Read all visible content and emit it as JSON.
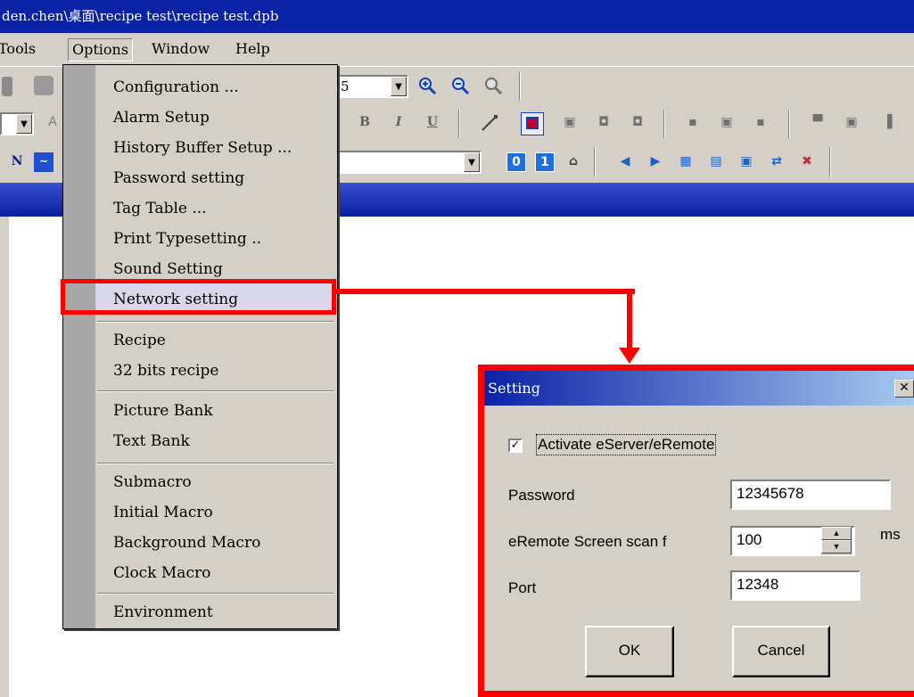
{
  "window": {
    "title": "den.chen\\桌面\\recipe test\\recipe test.dpb"
  },
  "menubar": {
    "tools": "Tools",
    "options": "Options",
    "window": "Window",
    "help": "Help"
  },
  "options_menu": {
    "items": [
      "Configuration ...",
      "Alarm Setup",
      "History Buffer Setup ...",
      "Password setting",
      "Tag Table ...",
      "Print Typesetting ..",
      "Sound Setting",
      "Network setting",
      "Recipe",
      "32 bits recipe",
      "Picture Bank",
      "Text Bank",
      "Submacro",
      "Initial Macro",
      "Background Macro",
      "Clock Macro",
      "Environment"
    ],
    "highlighted": "Network setting"
  },
  "toolbar": {
    "combo1_value": "5",
    "bold": "B",
    "italic": "I",
    "underline": "U"
  },
  "dialog": {
    "title": "Setting",
    "close": "✕",
    "activate_label": "Activate eServer/eRemote",
    "activate_checked": "✓",
    "password_label": "Password",
    "password_value": "12345678",
    "scan_label": "eRemote Screen scan f",
    "scan_value": "100",
    "scan_unit": "ms",
    "port_label": "Port",
    "port_value": "12348",
    "ok": "OK",
    "cancel": "Cancel"
  },
  "colors": {
    "title_blue": "#0a22a6",
    "highlight_red": "#ff0000",
    "menu_face": "#d4d0c8"
  },
  "icons": [
    "zoom-in-icon",
    "zoom-out-icon",
    "zoom-fit-icon",
    "line-tool-icon",
    "rectangle-tool-icon",
    "counter-0-icon",
    "counter-1-icon",
    "properties-icon",
    "back-icon",
    "forward-icon",
    "download-icon",
    "save-screen-icon",
    "close-screen-icon"
  ]
}
